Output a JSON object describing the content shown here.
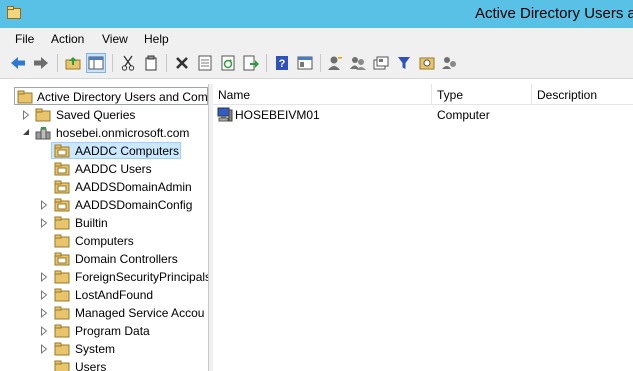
{
  "window": {
    "title": "Active Directory Users and"
  },
  "menu": [
    "File",
    "Action",
    "View",
    "Help"
  ],
  "toolbar": {
    "buttons": [
      "back-icon",
      "forward-icon",
      "up-folder-icon",
      "show-tree-icon",
      "cut-icon",
      "copy-icon",
      "delete-icon",
      "properties-icon",
      "refresh-icon",
      "export-list-icon",
      "help-icon",
      "mmc-view-icon",
      "add-user-icon",
      "add-group-icon",
      "add-ou-icon",
      "filter-icon",
      "find-icon",
      "add-to-group-icon"
    ]
  },
  "tree": {
    "root": "Active Directory Users and Com",
    "items": [
      {
        "label": "Saved Queries",
        "expander": "collapsed"
      },
      {
        "label": "hosebei.onmicrosoft.com",
        "expander": "expanded"
      },
      {
        "label": "AADDC Computers",
        "expander": "none",
        "selected": true
      },
      {
        "label": "AADDC Users",
        "expander": "none"
      },
      {
        "label": "AADDSDomainAdmin",
        "expander": "none"
      },
      {
        "label": "AADDSDomainConfig",
        "expander": "collapsed"
      },
      {
        "label": "Builtin",
        "expander": "collapsed"
      },
      {
        "label": "Computers",
        "expander": "none"
      },
      {
        "label": "Domain Controllers",
        "expander": "none"
      },
      {
        "label": "ForeignSecurityPrincipals",
        "expander": "collapsed"
      },
      {
        "label": "LostAndFound",
        "expander": "collapsed"
      },
      {
        "label": "Managed Service Accou",
        "expander": "collapsed"
      },
      {
        "label": "Program Data",
        "expander": "collapsed"
      },
      {
        "label": "System",
        "expander": "collapsed"
      },
      {
        "label": "Users",
        "expander": "none"
      }
    ]
  },
  "list": {
    "columns": [
      "Name",
      "Type",
      "Description"
    ],
    "rows": [
      {
        "name": "HOSEBEIVM01",
        "type": "Computer",
        "description": ""
      }
    ]
  },
  "colors": {
    "titlebar": "#5ac1e6",
    "selection": "#cce8ff",
    "folder": "#e8c46a"
  }
}
